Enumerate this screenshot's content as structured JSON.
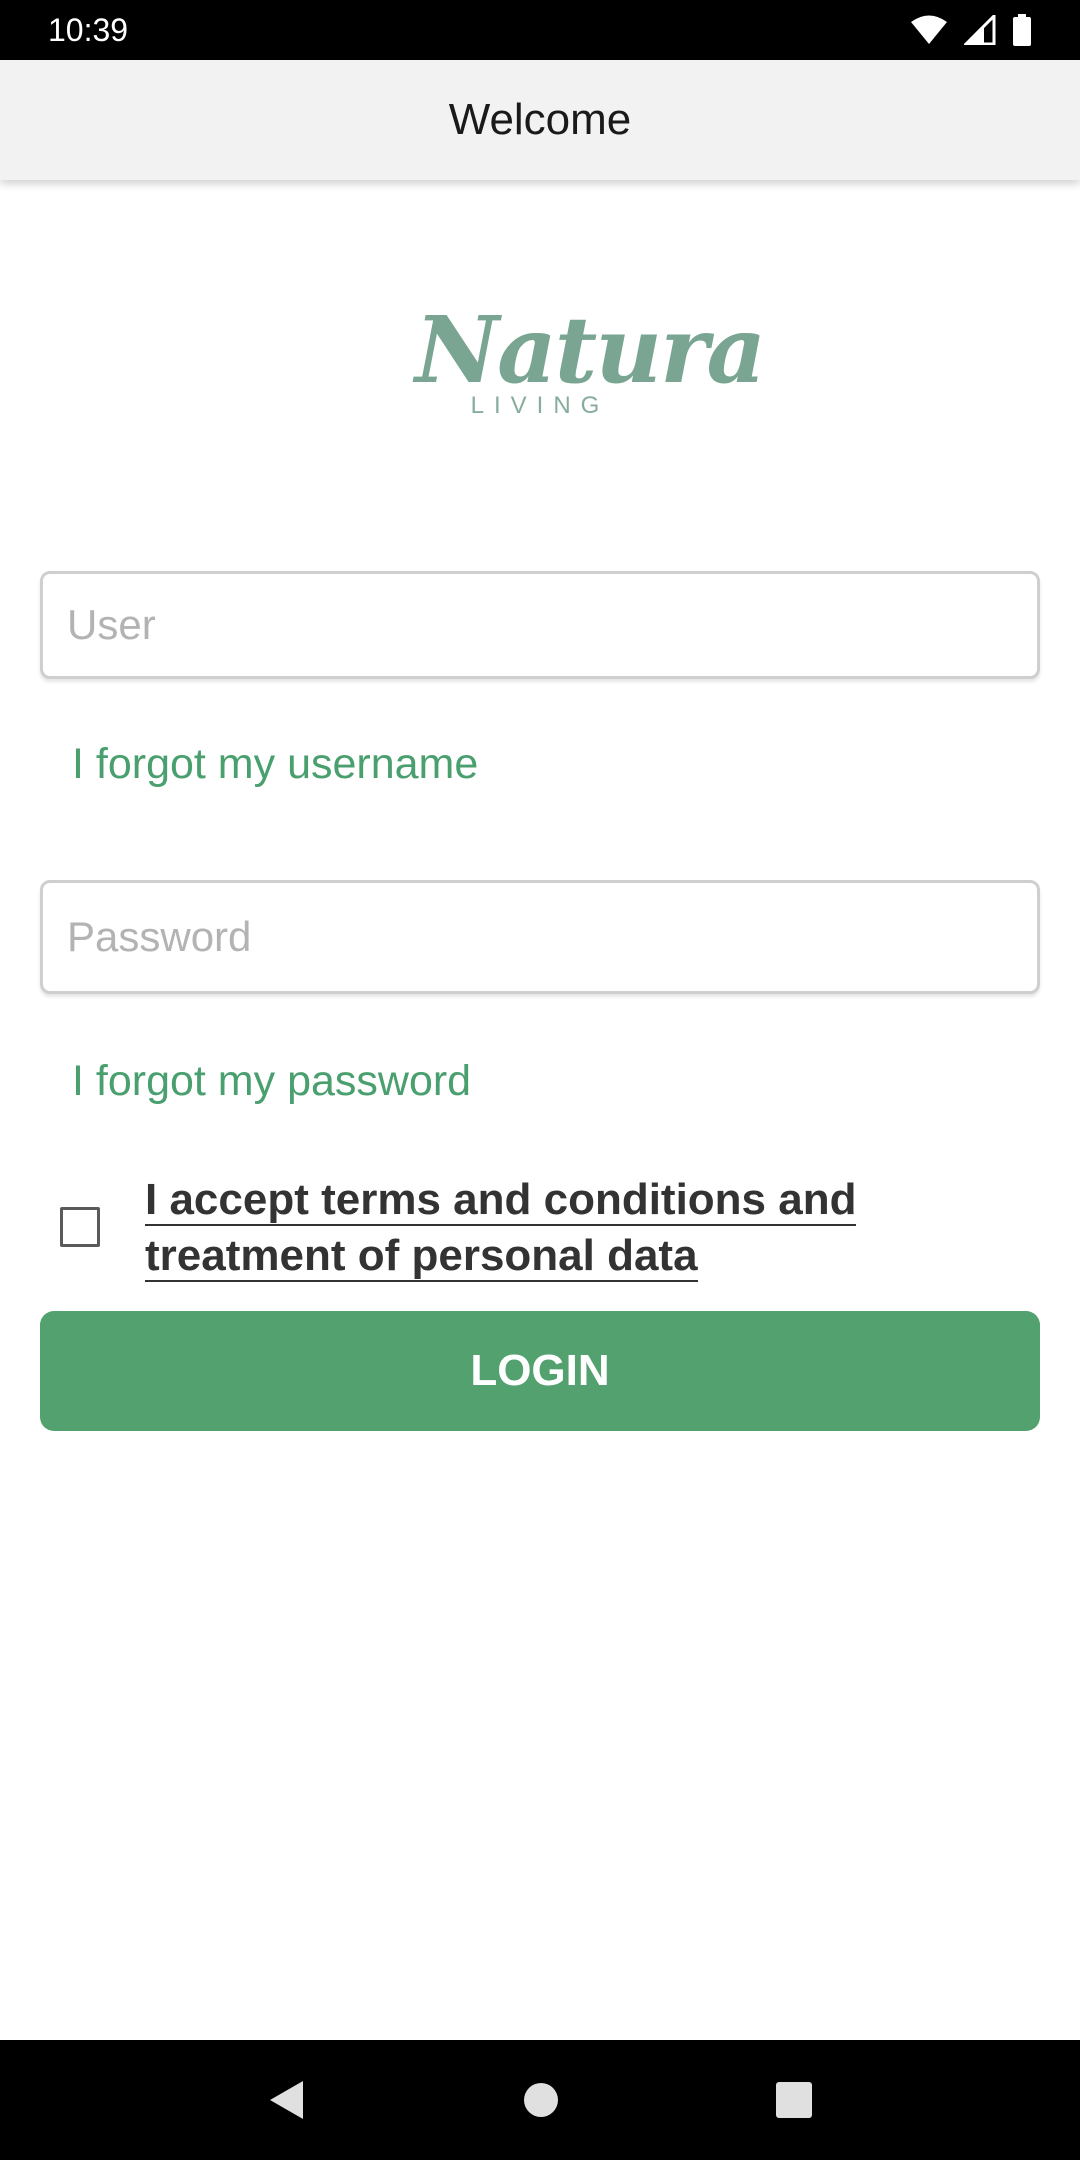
{
  "status_bar": {
    "time": "10:39",
    "icons": [
      "wifi-icon",
      "signal-icon",
      "battery-icon"
    ]
  },
  "app_bar": {
    "title": "Welcome"
  },
  "logo": {
    "script_text": "Natura",
    "sub_text": "LIVING",
    "color": "#7aa592"
  },
  "form": {
    "user_placeholder": "User",
    "user_value": "",
    "forgot_username": "I forgot my username",
    "password_placeholder": "Password",
    "password_value": "",
    "forgot_password": "I forgot my password",
    "terms_checked": false,
    "terms_text": "I accept terms and conditions and treatment of personal data",
    "login_label": "LOGIN"
  },
  "nav_bar": {
    "icons": [
      "back-icon",
      "home-icon",
      "recents-icon"
    ]
  },
  "colors": {
    "accent": "#52a16e",
    "link": "#4a9f6e",
    "app_bar_bg": "#f2f2f2"
  }
}
